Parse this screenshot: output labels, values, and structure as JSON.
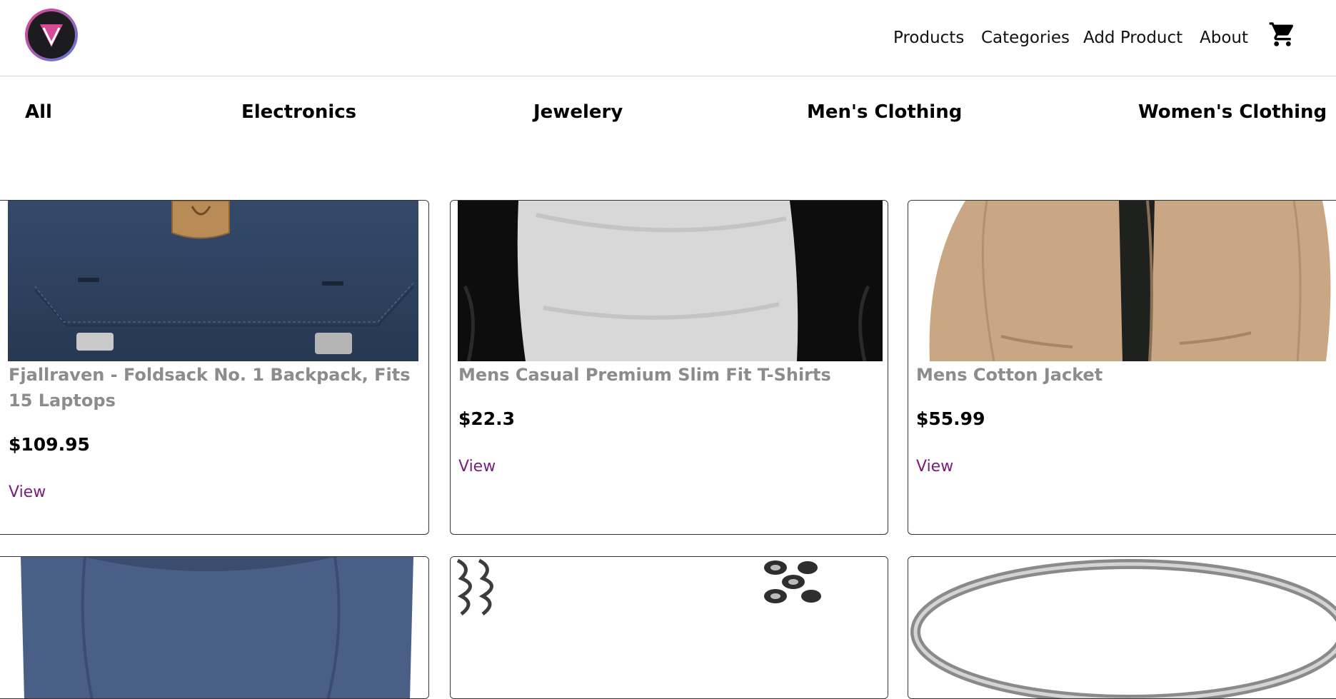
{
  "header": {
    "logo_icon": "v-logo-icon",
    "nav": {
      "products": "Products",
      "categories": "Categories",
      "add_product": "Add Product",
      "about": "About"
    },
    "cart_icon": "shopping-cart-icon"
  },
  "categories": {
    "all": "All",
    "electronics": "Electronics",
    "jewelery": "Jewelery",
    "mens": "Men's Clothing",
    "womens": "Women's Clothing"
  },
  "products": [
    {
      "title": "Fjallraven - Foldsack No. 1 Backpack, Fits 15 Laptops",
      "price": "$109.95",
      "view": "View",
      "image": "navy-backpack"
    },
    {
      "title": "Mens Casual Premium Slim Fit T-Shirts",
      "price": "$22.3",
      "view": "View",
      "image": "raglan-tshirt"
    },
    {
      "title": "Mens Cotton Jacket",
      "price": "$55.99",
      "view": "View",
      "image": "khaki-jacket"
    },
    {
      "image": "blue-shirt"
    },
    {
      "image": "silver-chain-bracelet"
    },
    {
      "image": "silver-ring"
    }
  ],
  "colors": {
    "title_gray": "#8c8c8c",
    "link_purple": "#7a1d7e",
    "logo_gradient": [
      "#e0458f",
      "#5b7bd6"
    ]
  }
}
